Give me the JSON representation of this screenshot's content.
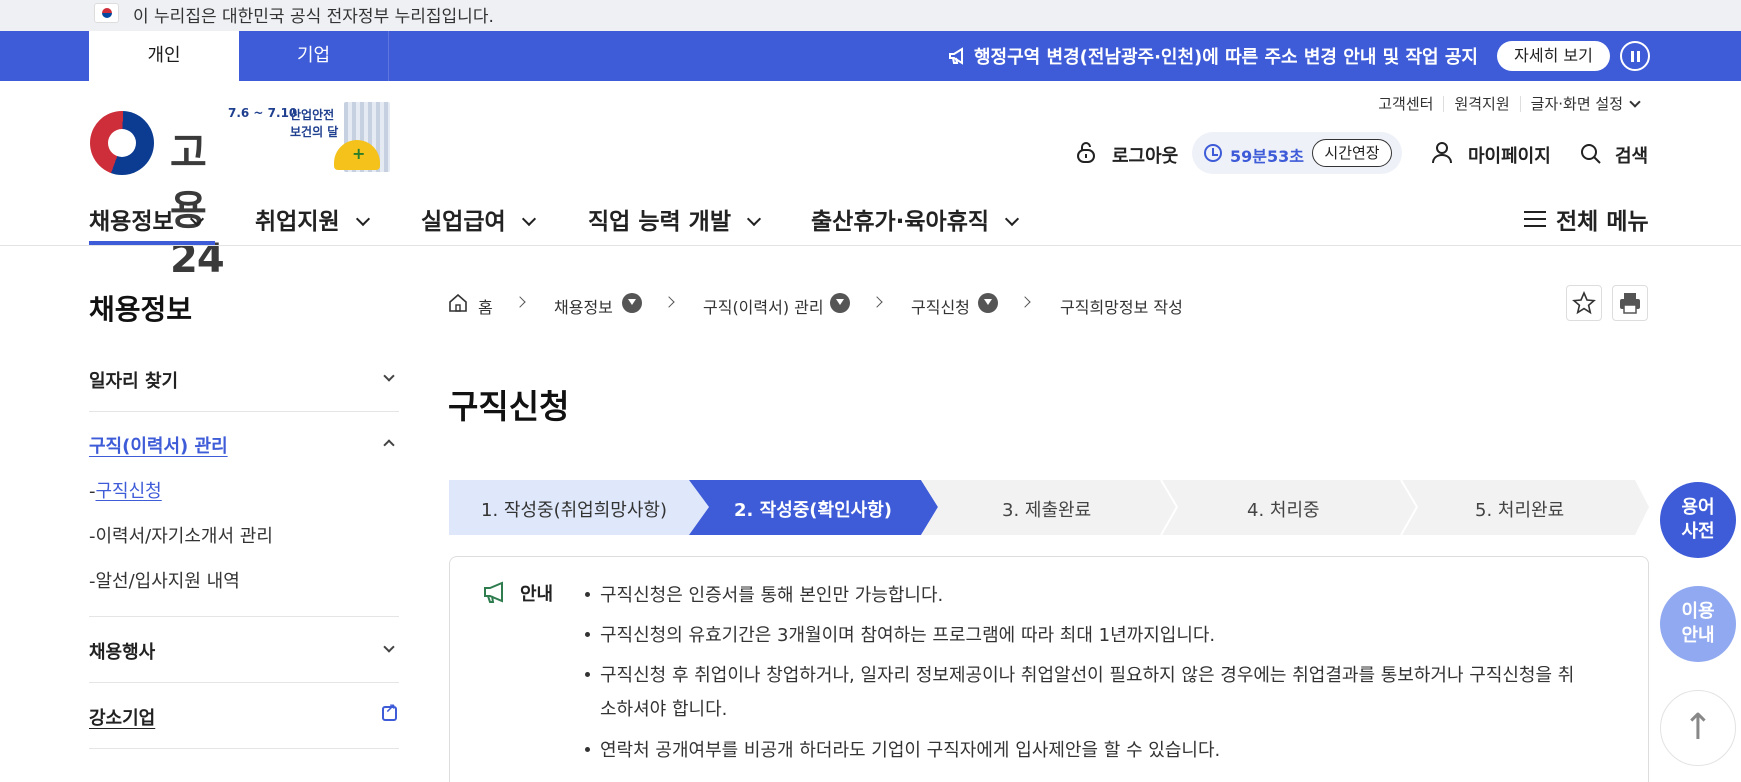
{
  "gov_banner": {
    "text": "이 누리집은 대한민국 공식 전자정부 누리집입니다."
  },
  "top_tabs": {
    "personal": "개인",
    "corporate": "기업"
  },
  "notice": {
    "text": "행정구역 변경(전남광주·인천)에 따른 주소 변경 안내 및 작업 공지",
    "more": "자세히 보기"
  },
  "logo": {
    "text": "고용24",
    "promo_date": "7.6 ~ 7.10",
    "promo_line1": "산업안전",
    "promo_line2": "보건의 달"
  },
  "util_links": [
    "고객센터",
    "원격지원",
    "글자·화면 설정"
  ],
  "session": {
    "logout": "로그아웃",
    "timer": "59분53초",
    "extend": "시간연장"
  },
  "header_actions": {
    "mypage": "마이페이지",
    "search": "검색"
  },
  "gnb": {
    "items": [
      "채용정보",
      "취업지원",
      "실업급여",
      "직업 능력 개발",
      "출산휴가·육아휴직"
    ],
    "all_menu": "전체 메뉴"
  },
  "sidebar": {
    "title": "채용정보",
    "items": [
      {
        "label": "일자리 찾기"
      },
      {
        "label": "구직(이력서) 관리",
        "subs": [
          "구직신청",
          "이력서/자기소개서 관리",
          "알선/입사지원 내역"
        ]
      },
      {
        "label": "채용행사"
      },
      {
        "label": "강소기업"
      }
    ]
  },
  "breadcrumb": [
    "홈",
    "채용정보",
    "구직(이력서) 관리",
    "구직신청",
    "구직희망정보 작성"
  ],
  "page": {
    "title": "구직신청"
  },
  "steps": [
    "1. 작성중(취업희망사항)",
    "2. 작성중(확인사항)",
    "3. 제출완료",
    "4. 처리중",
    "5. 처리완료"
  ],
  "info": {
    "label": "안내",
    "lines": [
      "구직신청은 인증서를 통해 본인만 가능합니다.",
      "구직신청의 유효기간은 3개월이며 참여하는 프로그램에 따라 최대 1년까지입니다.",
      "구직신청 후 취업이나 창업하거나, 일자리 정보제공이나 취업알선이 필요하지 않은 경우에는 취업결과를 통보하거나 구직신청을 취",
      "소하셔야 합니다.",
      "연락처 공개여부를 비공개 하더라도 기업이 구직자에게 입사제안을 할 수 있습니다."
    ]
  },
  "floating": {
    "terms_line1": "용어",
    "terms_line2": "사전",
    "guide_line1": "이용",
    "guide_line2": "안내",
    "top": "↑"
  },
  "colors": {
    "primary": "#3e5bd8",
    "step_done": "#dfe8fb",
    "step_pending": "#f2f2f2"
  }
}
